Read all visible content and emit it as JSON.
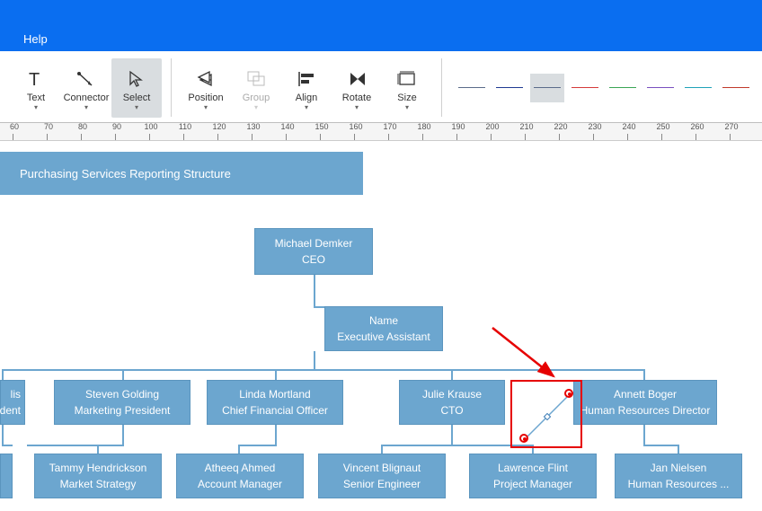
{
  "topbar": {
    "help": "Help"
  },
  "ribbon": {
    "text": "Text",
    "connector": "Connector",
    "select": "Select",
    "position": "Position",
    "group": "Group",
    "align": "Align",
    "rotate": "Rotate",
    "size": "Size"
  },
  "ruler_ticks": [
    60,
    70,
    80,
    90,
    100,
    110,
    120,
    130,
    140,
    150,
    160,
    170,
    180,
    190,
    200,
    210,
    220,
    230,
    240,
    250,
    260,
    270
  ],
  "line_styles": [
    {
      "color": "#5b6b8a",
      "sel": false
    },
    {
      "color": "#1f3a93",
      "sel": false
    },
    {
      "color": "#5b6b8a",
      "sel": true
    },
    {
      "color": "#d43a3a",
      "sel": false
    },
    {
      "color": "#3aa655",
      "sel": false
    },
    {
      "color": "#7a4fbf",
      "sel": false
    },
    {
      "color": "#1fa2b8",
      "sel": false
    },
    {
      "color": "#c0392b",
      "sel": false
    }
  ],
  "diagram": {
    "title": "Purchasing Services Reporting Structure",
    "nodes": {
      "ceo": {
        "name": "Michael Demker",
        "role": "CEO"
      },
      "ea": {
        "name": "Name",
        "role": "Executive Assistant"
      },
      "lis": {
        "name": "lis",
        "role": "dent"
      },
      "mkt": {
        "name": "Steven Golding",
        "role": "Marketing President"
      },
      "cfo": {
        "name": "Linda Mortland",
        "role": "Chief Financial Officer"
      },
      "cto": {
        "name": "Julie Krause",
        "role": "CTO"
      },
      "hr": {
        "name": "Annett Boger",
        "role": "Human Resources Director"
      },
      "ms": {
        "name": "Tammy Hendrickson",
        "role": "Market Strategy"
      },
      "am": {
        "name": "Atheeq Ahmed",
        "role": "Account Manager"
      },
      "se": {
        "name": "Vincent Blignaut",
        "role": "Senior Engineer"
      },
      "pm": {
        "name": "Lawrence Flint",
        "role": "Project Manager"
      },
      "hr2": {
        "name": "Jan Nielsen",
        "role": "Human Resources ..."
      }
    }
  },
  "colors": {
    "brand": "#0a6ef0",
    "node": "#6ca6cf",
    "sel": "#e60000"
  }
}
